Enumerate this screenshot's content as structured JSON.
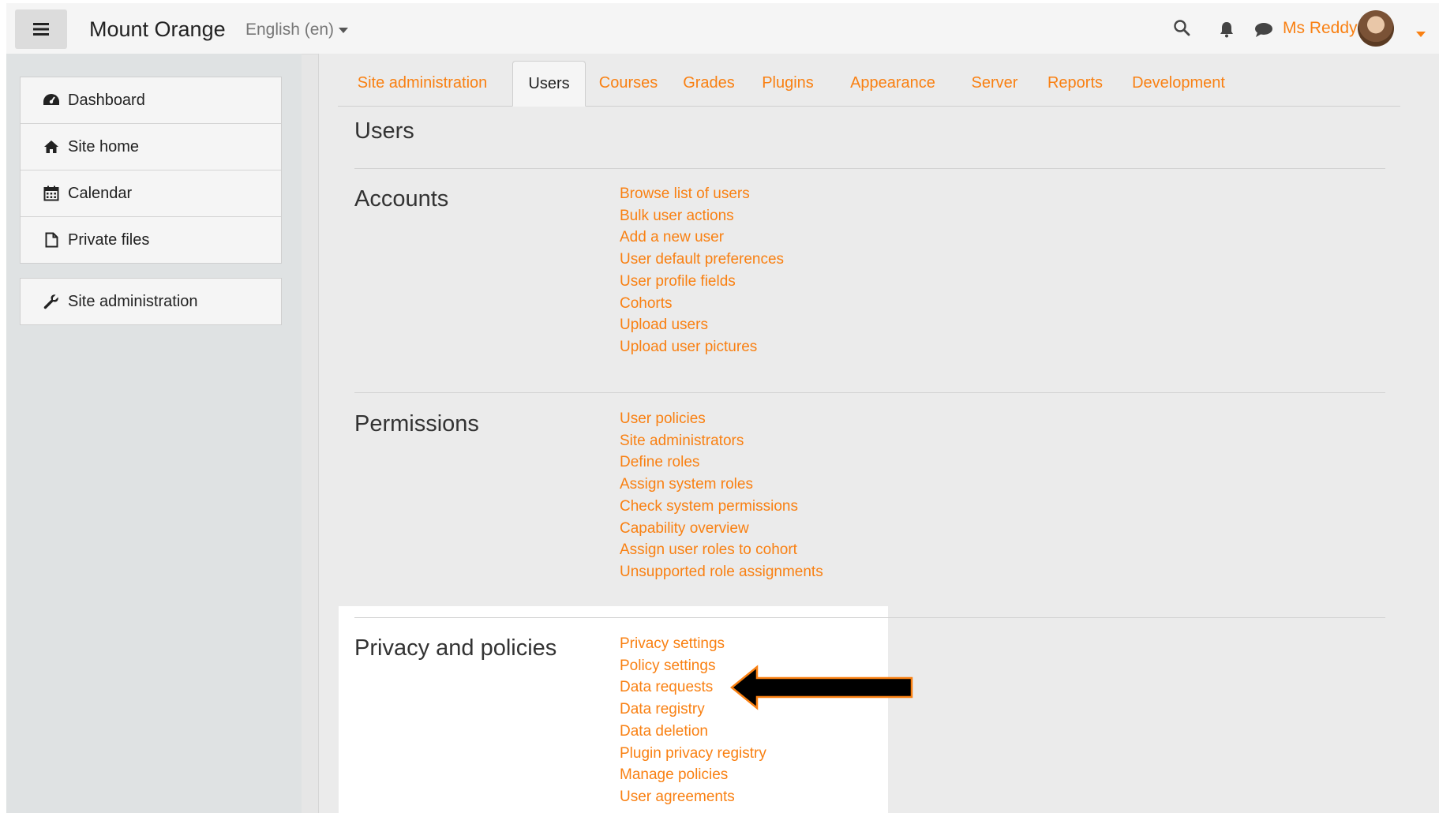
{
  "navbar": {
    "site_name": "Mount Orange",
    "language": "English (en)",
    "user_name": "Ms Reddy",
    "icons": [
      "menu-icon",
      "search-icon",
      "bell-icon",
      "chat-icon"
    ],
    "accent_color": "#f98012"
  },
  "sidebar": {
    "items": [
      {
        "label": "Dashboard",
        "icon": "dashboard-icon"
      },
      {
        "label": "Site home",
        "icon": "home-icon"
      },
      {
        "label": "Calendar",
        "icon": "calendar-icon"
      },
      {
        "label": "Private files",
        "icon": "file-icon"
      }
    ],
    "admin_item": {
      "label": "Site administration",
      "icon": "wrench-icon"
    }
  },
  "tabs": [
    {
      "label": "Site administration",
      "active": false
    },
    {
      "label": "Users",
      "active": true
    },
    {
      "label": "Courses",
      "active": false
    },
    {
      "label": "Grades",
      "active": false
    },
    {
      "label": "Plugins",
      "active": false
    },
    {
      "label": "Appearance",
      "active": false
    },
    {
      "label": "Server",
      "active": false
    },
    {
      "label": "Reports",
      "active": false
    },
    {
      "label": "Development",
      "active": false
    }
  ],
  "page": {
    "heading": "Users",
    "sections": [
      {
        "title": "Accounts",
        "links": [
          "Browse list of users",
          "Bulk user actions",
          "Add a new user",
          "User default preferences",
          "User profile fields",
          "Cohorts",
          "Upload users",
          "Upload user pictures"
        ]
      },
      {
        "title": "Permissions",
        "links": [
          "User policies",
          "Site administrators",
          "Define roles",
          "Assign system roles",
          "Check system permissions",
          "Capability overview",
          "Assign user roles to cohort",
          "Unsupported role assignments"
        ]
      },
      {
        "title": "Privacy and policies",
        "links": [
          "Privacy settings",
          "Policy settings",
          "Data requests",
          "Data registry",
          "Data deletion",
          "Plugin privacy registry",
          "Manage policies",
          "User agreements"
        ]
      }
    ]
  },
  "annotation": {
    "arrow_color": "#000000",
    "arrow_border": "#f98012",
    "points_to": "Data requests"
  }
}
